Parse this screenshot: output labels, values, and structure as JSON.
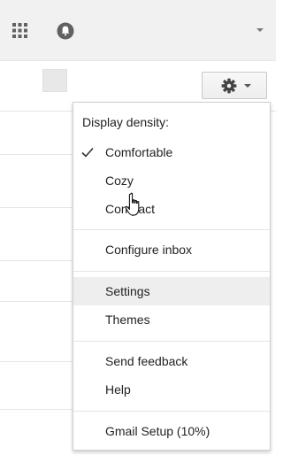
{
  "header": {
    "apps_icon": "apps-grid-icon",
    "notifications_icon": "notifications-icon",
    "account_chevron_icon": "chevron-down-icon"
  },
  "toolbar": {
    "select_checkbox": "select-all-checkbox",
    "settings_icon": "gear-icon",
    "settings_chevron_icon": "chevron-down-icon"
  },
  "settings_menu": {
    "density_label": "Display density:",
    "density_options": [
      {
        "label": "Comfortable",
        "checked": true
      },
      {
        "label": "Cozy",
        "checked": false
      },
      {
        "label": "Compact",
        "checked": false
      }
    ],
    "configure_inbox": "Configure inbox",
    "settings": "Settings",
    "themes": "Themes",
    "send_feedback": "Send feedback",
    "help": "Help",
    "gmail_setup": "Gmail Setup (10%)"
  },
  "colors": {
    "header_bg": "#f1f1f1",
    "hover_bg": "#eeeeee",
    "text": "#222222",
    "icon": "#666666"
  }
}
